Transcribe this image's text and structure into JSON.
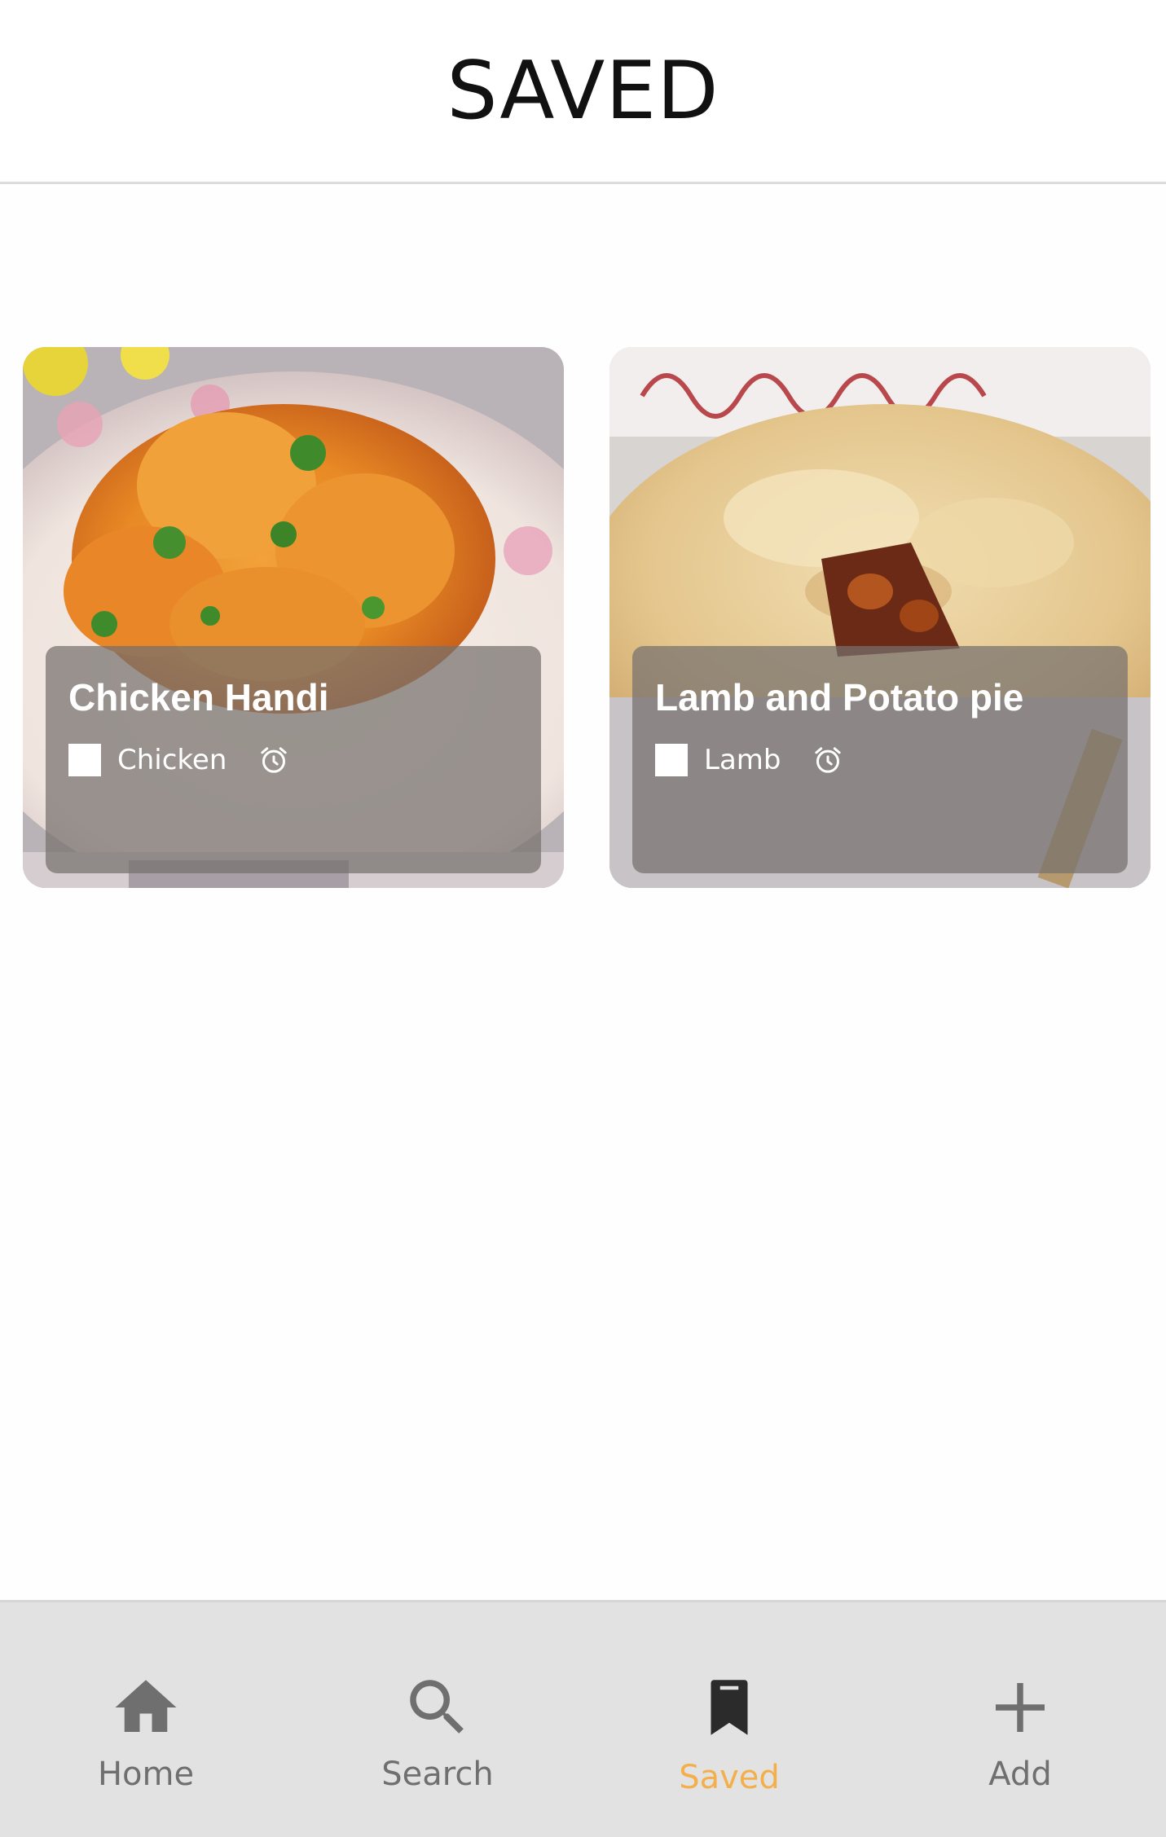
{
  "header": {
    "title": "SAVED"
  },
  "saved_recipes": [
    {
      "name": "Chicken Handi",
      "category": "Chicken",
      "checkbox_checked": false,
      "icon": "alarm-clock-icon"
    },
    {
      "name": "Lamb and Potato pie",
      "category": "Lamb",
      "checkbox_checked": false,
      "icon": "alarm-clock-icon"
    }
  ],
  "bottom_nav": {
    "items": [
      {
        "label": "Home",
        "icon": "home-icon",
        "active": false
      },
      {
        "label": "Search",
        "icon": "search-icon",
        "active": false
      },
      {
        "label": "Saved",
        "icon": "bookmark-icon",
        "active": true
      },
      {
        "label": "Add",
        "icon": "plus-icon",
        "active": false
      }
    ],
    "active_color": "#f4ae4a",
    "inactive_color": "#6f6f6f"
  }
}
